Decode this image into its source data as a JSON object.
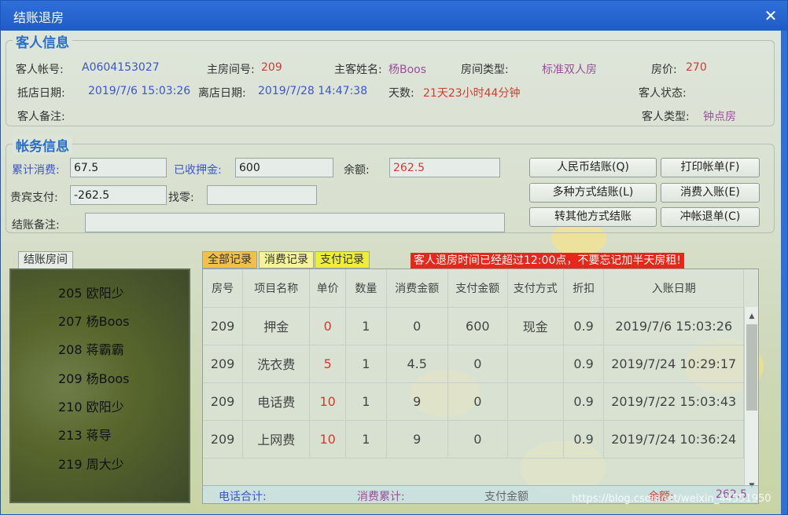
{
  "window": {
    "title": "结账退房"
  },
  "guest_info": {
    "legend": "客人信息",
    "account_label": "客人帐号:",
    "account": "A0604153027",
    "room_label": "主房间号:",
    "room": "209",
    "name_label": "主客姓名:",
    "name": "杨Boos",
    "room_type_label": "房间类型:",
    "room_type": "标准双人房",
    "price_label": "房价:",
    "price": "270",
    "checkin_label": "抵店日期:",
    "checkin": "2019/7/6 15:03:26",
    "checkout_label": "离店日期:",
    "checkout": "2019/7/28 14:47:38",
    "days_label": "天数:",
    "days": "21天23小时44分钟",
    "status_label": "客人状态:",
    "note_label": "客人备注:",
    "guest_type_label": "客人类型:",
    "guest_type": "钟点房"
  },
  "account_info": {
    "legend": "帐务信息",
    "total_consume_label": "累计消费:",
    "total_consume": "67.5",
    "deposit_label": "已收押金:",
    "deposit": "600",
    "balance_label": "余额:",
    "balance": "262.5",
    "vip_pay_label": "贵宾支付:",
    "vip_pay": "-262.5",
    "change_label": "找零:",
    "change": "",
    "settle_note_label": "结账备注:",
    "settle_note": "",
    "buttons": {
      "rmb_settle": "人民币结账(Q)",
      "print_bill": "打印帐单(F)",
      "multi_settle": "多种方式结账(L)",
      "consume_entry": "消费入账(E)",
      "other_settle": "转其他方式结账",
      "reverse_refund": "冲帐退单(C)"
    }
  },
  "left_panel": {
    "tab": "结账房间",
    "rooms": [
      "205 欧阳少",
      "207 杨Boos",
      "208 蒋霸霸",
      "209 杨Boos",
      "210 欧阳少",
      "213 蒋导",
      "219 周大少"
    ]
  },
  "tabs": {
    "all": "全部记录",
    "consume": "消费记录",
    "payment": "支付记录"
  },
  "warning": "客人退房时间已经超过12:00点，不要忘记加半天房租!",
  "table": {
    "headers": [
      "房号",
      "项目名称",
      "单价",
      "数量",
      "消费金额",
      "支付金额",
      "支付方式",
      "折扣",
      "入账日期"
    ],
    "rows": [
      [
        "209",
        "押金",
        "0",
        "1",
        "0",
        "600",
        "现金",
        "0.9",
        "2019/7/6 15:03:26"
      ],
      [
        "209",
        "洗衣费",
        "5",
        "1",
        "4.5",
        "0",
        "",
        "0.9",
        "2019/7/24 10:29:17"
      ],
      [
        "209",
        "电话费",
        "10",
        "1",
        "9",
        "0",
        "",
        "0.9",
        "2019/7/22 15:03:43"
      ],
      [
        "209",
        "上网费",
        "10",
        "1",
        "9",
        "0",
        "",
        "0.9",
        "2019/7/24 10:36:24"
      ]
    ]
  },
  "footer": {
    "phone_total": "电话合计:",
    "consume_total": "消费累计:",
    "pay_total": "支付金额",
    "balance_label": "余额:",
    "balance": "262.5",
    "watermark": "https://blog.csdn.net/weixin_44551950"
  },
  "colors": {
    "title_bar": "#1f5cc8",
    "legend": "#2a6fc9",
    "value_blue": "#3b56c9",
    "value_red": "#d23a32",
    "value_purple": "#9a4f9a",
    "warning_bg": "#e8261a",
    "tab_all": "#f1c04a",
    "tab_consume": "#f4f39a",
    "tab_payment": "#eeee3a"
  }
}
